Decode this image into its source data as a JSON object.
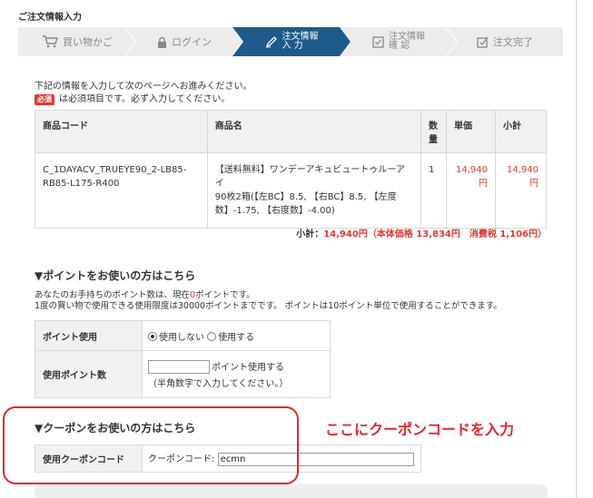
{
  "page": {
    "heading": "ご注文情報入力"
  },
  "steps": [
    {
      "label": "買い物かご",
      "icon": "cart-icon",
      "state": "done"
    },
    {
      "label": "ログイン",
      "icon": "lock-icon",
      "state": "done"
    },
    {
      "label_line1": "注文情報",
      "label_line2": "入 力",
      "icon": "pen-icon",
      "state": "active"
    },
    {
      "label_line1": "注文情報",
      "label_line2": "確 認",
      "icon": "check-box-icon",
      "state": "todo"
    },
    {
      "label": "注文完了",
      "icon": "complete-icon",
      "state": "todo"
    }
  ],
  "intro": {
    "line1": "下記の情報を入力して次のページへお進みください。",
    "required_badge": "必須",
    "line2": "は必須項目です。必ず入力してください。"
  },
  "product_table": {
    "headers": {
      "code": "商品コード",
      "name": "商品名",
      "qty_1": "数",
      "qty_2": "量",
      "unit_price": "単価",
      "subtotal": "小計"
    },
    "rows": [
      {
        "code_1": "C_1DAYACV_TRUEYE90_2-LB85-",
        "code_2": "RB85-L175-R400",
        "name_1": "【送料無料】ワンデーアキュビュートゥルーアイ",
        "name_2": "90枚2箱(【左BC】8.5, 【右BC】8.5, 【左度",
        "name_3": "数】-1.75, 【右度数】-4.00)",
        "qty": "1",
        "unit_price_1": "14,940",
        "unit_price_2": "円",
        "subtotal_1": "14,940",
        "subtotal_2": "円"
      }
    ]
  },
  "subtotal": {
    "label": "小計：",
    "amount": "14,940円",
    "detail": "（本体価格 13,834円　消費税 1,106円）"
  },
  "points": {
    "title": "▼ポイントをお使いの方はこちら",
    "line1_prefix": "あなたのお手持ちのポイント数は、現在",
    "line1_value": "0",
    "line1_suffix": "ポイントです。",
    "line2": "1度の買い物で使用できる使用限度は30000ポイントまでです。 ポイントは10ポイント単位で使用することができます。",
    "use_label": "ポイント使用",
    "option_no": "使用しない",
    "option_yes": "使用する",
    "amount_label": "使用ポイント数",
    "amount_value": "",
    "amount_suffix": "ポイント使用する",
    "amount_note": "（半角数字で入力してください。）"
  },
  "coupon": {
    "title": "▼クーポンをお使いの方はこちら",
    "row_label": "使用クーポンコード",
    "field_label": "クーポンコード:",
    "field_value": "ecmn"
  },
  "annotation": {
    "text": "ここにクーポンコードを入力",
    "color": "#e0282a"
  },
  "colors": {
    "accent": "#e03a2e",
    "active_step": "#1f5a8d",
    "step_bg": "#ececec"
  }
}
